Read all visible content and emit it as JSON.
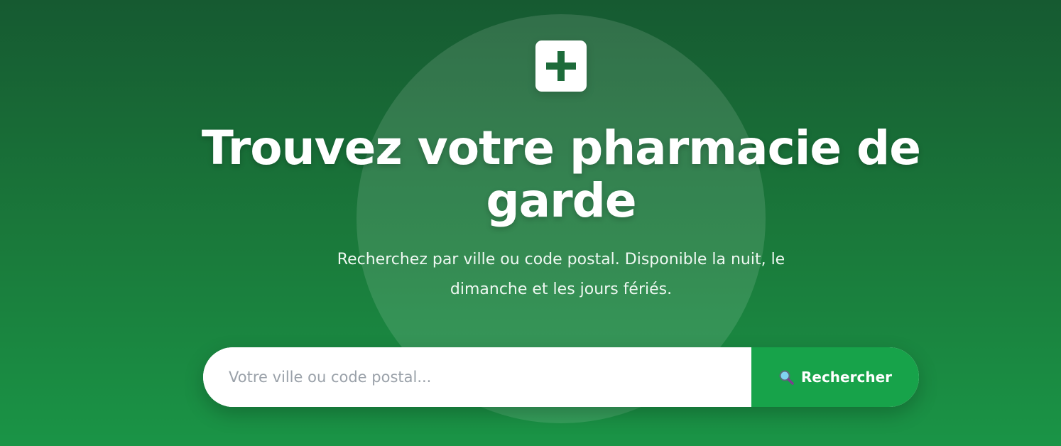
{
  "hero": {
    "title": "Trouvez votre pharmacie de garde",
    "subtitle": "Recherchez par ville ou code postal. Disponible la nuit, le dimanche et les jours fériés."
  },
  "search": {
    "placeholder": "Votre ville ou code postal...",
    "value": "",
    "button_label": "Rechercher"
  },
  "icons": {
    "logo": "pharmacy-cross-icon",
    "search": "magnifier-icon"
  },
  "colors": {
    "background_top": "#165a31",
    "background_bottom": "#1a9446",
    "accent": "#17a34a",
    "text": "#ffffff"
  }
}
